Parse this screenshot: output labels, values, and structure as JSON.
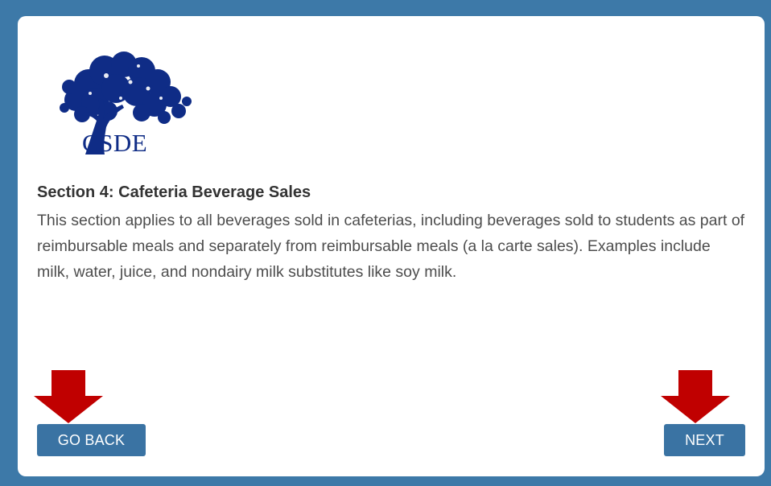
{
  "logo": {
    "text": "CSDE",
    "icon": "tree-icon",
    "color": "#0f2c86"
  },
  "section": {
    "title": "Section 4: Cafeteria Beverage Sales",
    "body": "This section applies to all beverages sold in cafeterias, including beverages sold to students as part of reimbursable meals and separately from reimbursable meals (a la carte sales). Examples include milk, water, juice, and nondairy milk substitutes like soy milk."
  },
  "navigation": {
    "back_label": "GO BACK",
    "next_label": "NEXT"
  },
  "annotations": {
    "arrow_icon": "arrow-down-icon",
    "arrow_color": "#c00000"
  },
  "colors": {
    "frame": "#3d79a8",
    "button": "#3a73a3",
    "card": "#ffffff"
  }
}
